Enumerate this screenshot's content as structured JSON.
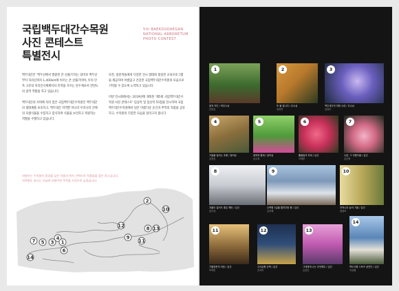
{
  "title_lines": [
    "국립백두대간수목원",
    "사진 콘테스트",
    "특별전시"
  ],
  "subtitle_en_lines": [
    "5th BAEKDUDAEGAN",
    "NATIONAL ARBORETUM",
    "PHOTO CONTEST"
  ],
  "body_col1": [
    "백두대간은 '백두산에서 발원된 큰 산줄기'라는 의미로 백두산부터 지리산까지 1,400km에 이르는 큰 산줄기이며, 우리 민족 고유의 지리인식체계이자 유역을 가르는 분수계로서 한반도의 골격 역할을 하고 있습니다.",
    "백두대간의 자락에 자리 잡은 국립백두대간수목원은 백두대간의 생태계를 보호하고, 백두대간 지역뿐 아니라 우리나라 전체의 자생식물을 수집하고 증식하여 식물을 보전하고 복원하는 역할을 수행하고 있습니다."
  ],
  "body_col2": [
    "또한, 방문객들에게 다양한 전시 형태와 풍성한 교육프로그램을 제공하여 아름답고 건강한 국립백두대간수목원의 모습으로 기억될 수 있도록 노력하고 있습니다.",
    "이번 전시회에서는 2019년에 개최된 '제5회 국립백두대간수목원 사진 콘테스트' 입상작 및 입선작 55점을 전시하여 국립백두대간수목원에서 담은 아름다운 순간과 추억의 작품을 공유하고, 수목원의 다양한 모습을 알리고자 합니다."
  ],
  "map_caption_lines": [
    "지형이는 수목원의 풍경을 담은 작품의 위치 선택으로 작품들을 찾은 장소입니다.",
    "지역명도 표시는 가님에 지형이면 주목을 사진으로 남겼습니다."
  ],
  "map_markers": [
    "2",
    "10",
    "12",
    "8",
    "13",
    "9",
    "11",
    "4",
    "7",
    "5",
    "3",
    "1",
    "6",
    "14"
  ],
  "photos": [
    {
      "num": "1",
      "title": "꽃과 여인 / 최주수상",
      "author": "김영호",
      "color": "#3c6a2e"
    },
    {
      "num": "2",
      "title": "또 물 접니다 / 우수상",
      "author": "장영천",
      "color": "#b8792c"
    },
    {
      "num": "3",
      "title": "백두대간의 여왕 수련 / 우수상",
      "author": "김영주",
      "color": "#6b5fbf"
    },
    {
      "num": "4",
      "title": "가을을 걸리는 추풍 / 장려상",
      "author": "김영호",
      "color": "#8a6e3c"
    },
    {
      "num": "5",
      "title": "꽃하와 할께 / 장려상",
      "author": "남수정",
      "color": "#4f9a3a"
    },
    {
      "num": "6",
      "title": "튤울림의 자태 / 입선",
      "author": "이해준",
      "color": "#c8305a"
    },
    {
      "num": "7",
      "title": "수련, 그 아름다움 / 입선",
      "author": "김진희",
      "color": "#d26a86"
    },
    {
      "num": "8",
      "title": "겨울이 걸어도 좋은 해탄 / 입선",
      "author": "장주영",
      "color": "#c9ccd2"
    },
    {
      "num": "9",
      "title": "수목원 3길을 펼치다한 풍 / 입선",
      "author": "김지혜",
      "color": "#7d98b8"
    },
    {
      "num": "10",
      "title": "자작나무 숲의 가을 / 입선",
      "author": "정광조",
      "color": "#b9a85a"
    },
    {
      "num": "11",
      "title": "가을영문의 미팅 / 입선",
      "author": "조제민",
      "color": "#8c6a3a"
    },
    {
      "num": "12",
      "title": "고산습원 산책 / 입선",
      "author": "전서미",
      "color": "#2f4e7a"
    },
    {
      "num": "13",
      "title": "그대에게 나는 무엇해주 / 입선",
      "author": "김성인",
      "color": "#c05ab0"
    },
    {
      "num": "14",
      "title": "목도서원 스토츠 공연단 / 입선",
      "author": "이상철",
      "color": "#5a86b8"
    }
  ]
}
